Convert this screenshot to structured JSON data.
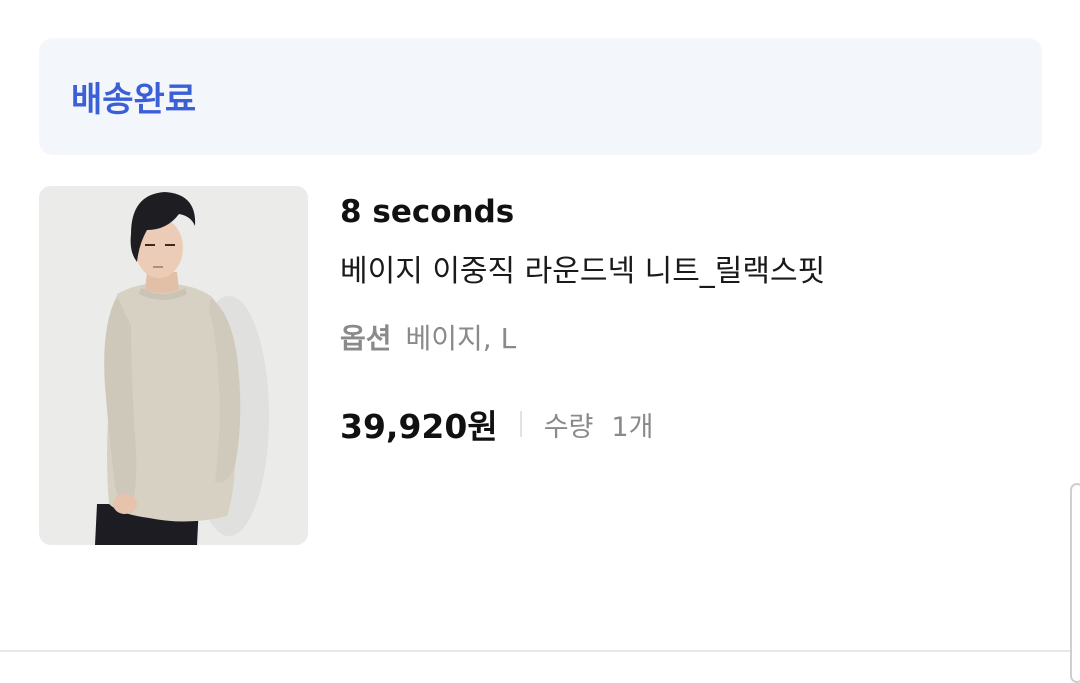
{
  "status": {
    "label": "배송완료",
    "color": "#3a5fd6"
  },
  "item": {
    "image_alt": "model-wearing-beige-knit",
    "brand": "8 seconds",
    "name": "베이지 이중직 라운드넥 니트_릴랙스핏",
    "option_label": "옵션",
    "option_value": "베이지, L",
    "price": "39,920원",
    "quantity_label": "수량",
    "quantity_value": "1개"
  }
}
